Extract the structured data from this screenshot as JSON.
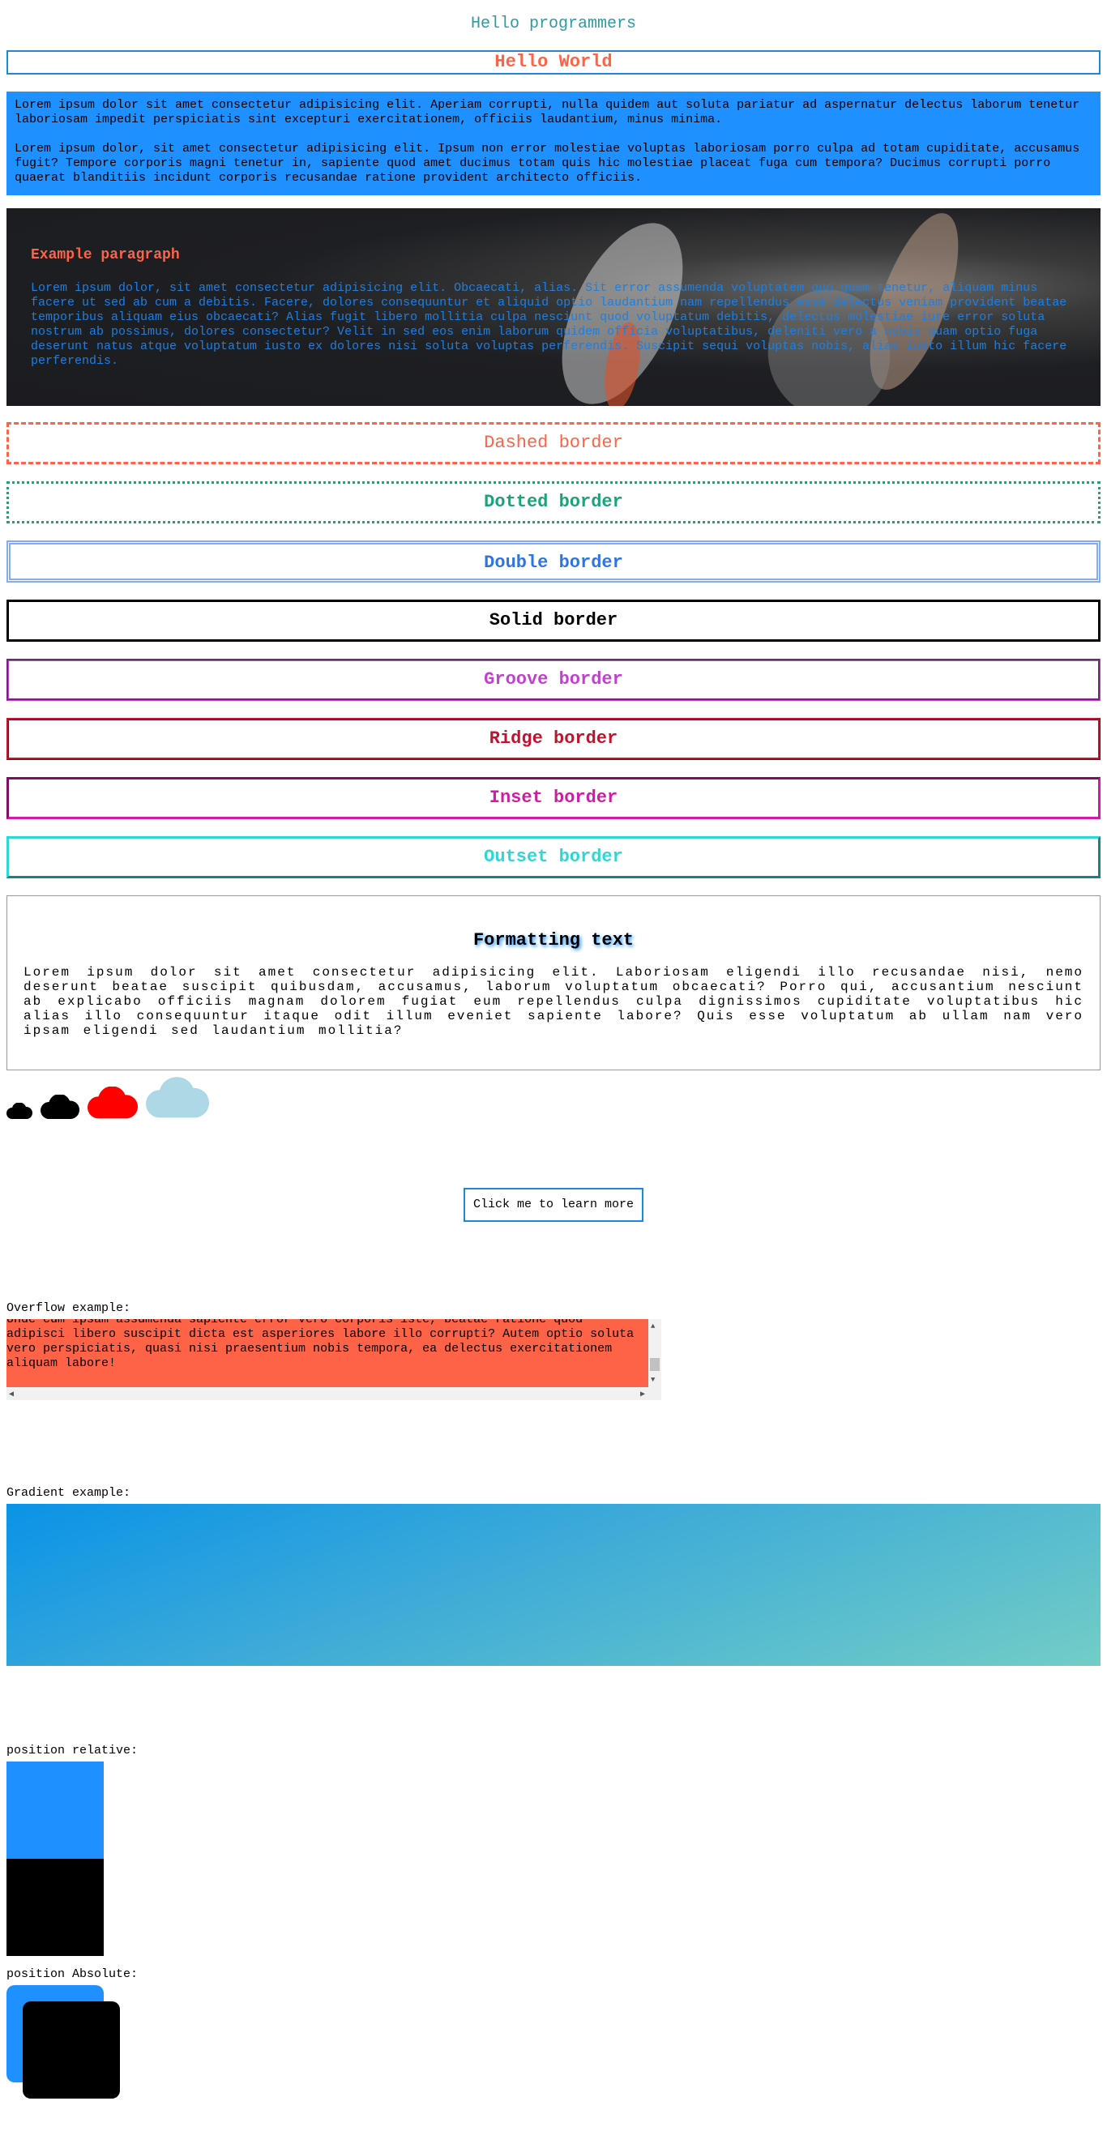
{
  "header": {
    "title": "Hello programmers",
    "hello": "Hello World"
  },
  "intro": {
    "p1": "Lorem ipsum dolor sit amet consectetur adipisicing elit. Aperiam corrupti, nulla quidem aut soluta pariatur ad aspernatur delectus laborum tenetur laboriosam impedit perspiciatis sint excepturi exercitationem, officiis laudantium, minus minima.",
    "p2": "Lorem ipsum dolor, sit amet consectetur adipisicing elit. Ipsum non error molestiae voluptas laboriosam porro culpa ad totam cupiditate, accusamus fugit? Tempore corporis magni tenetur in, sapiente quod amet ducimus totam quis hic molestiae placeat fuga cum tempora? Ducimus corrupti porro quaerat blanditiis incidunt corporis recusandae ratione provident architecto officiis."
  },
  "hero": {
    "heading": "Example paragraph",
    "text": "Lorem ipsum dolor, sit amet consectetur adipisicing elit. Obcaecati, alias. Sit error assumenda voluptatem quo quam tenetur, aliquam minus facere ut sed ab cum a debitis. Facere, dolores consequuntur et aliquid optio laudantium nam repellendus esse delectus veniam provident beatae temporibus aliquam eius obcaecati? Alias fugit libero mollitia culpa nesciunt quod voluptatum debitis, delectus molestiae iure error soluta nostrum ab possimus, dolores consectetur? Velit in sed eos enim laborum quidem officia voluptatibus, deleniti vero a nobis quam optio fuga deserunt natus atque voluptatum iusto ex dolores nisi soluta voluptas perferendis. Suscipit sequi voluptas nobis, alias iusto illum hic facere perferendis."
  },
  "borders": {
    "dashed": "Dashed border",
    "dotted": "Dotted border",
    "double": "Double border",
    "solid": "Solid border",
    "groove": "Groove border",
    "ridge": "Ridge border",
    "inset": "Inset border",
    "outset": "Outset border"
  },
  "formatting": {
    "heading": "Formatting text",
    "text": "Lorem ipsum dolor sit amet consectetur adipisicing elit. Laboriosam eligendi illo recusandae nisi, nemo deserunt beatae suscipit quibusdam, accusamus, laborum voluptatum obcaecati? Porro qui, accusantium nesciunt ab explicabo officiis magnam dolorem fugiat eum repellendus culpa dignissimos cupiditate voluptatibus hic alias illo consequuntur itaque odit illum eveniet sapiente labore? Quis esse voluptatum ab ullam nam vero ipsam eligendi sed laudantium mollitia?"
  },
  "clouds": {
    "icon": "cloud-icon",
    "colors": [
      "#000000",
      "#000000",
      "#ff0000",
      "#add8e6"
    ]
  },
  "learn": {
    "button": "Click me to learn more"
  },
  "overflow": {
    "label": "Overflow example:",
    "text": "Unde cum ipsam assumenda sapiente error vero corporis iste, beatae ratione quod adipisci libero suscipit dicta est asperiores labore illo corrupti? Autem optio soluta vero perspiciatis, quasi nisi praesentium nobis tempora, ea delectus exercitationem aliquam labore!"
  },
  "gradient": {
    "label": "Gradient example:"
  },
  "position": {
    "relative_label": "position relative:",
    "absolute_label": "position Absolute:"
  },
  "colors": {
    "accent_blue": "#1e90ff",
    "tomato": "#ff6347"
  }
}
